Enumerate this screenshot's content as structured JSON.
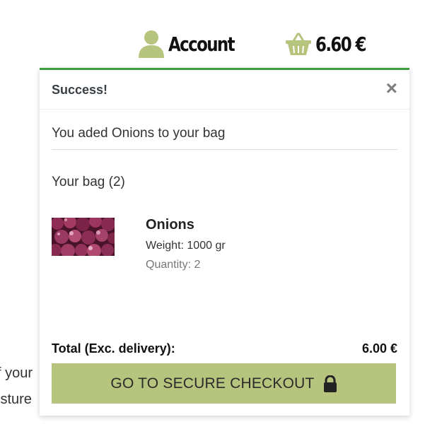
{
  "header": {
    "account_label": "Account",
    "bag_total": "6.60 €",
    "icon_color": "#b6c47e"
  },
  "background": {
    "line1": "f your",
    "line2": "isture"
  },
  "toast": {
    "title": "Success!",
    "close_symbol": "×",
    "message": "You aded Onions to your bag",
    "bag_count": "Your bag (2)",
    "accent_color": "#3d9d3f",
    "item": {
      "name": "Onions",
      "weight": "Weight: 1000 gr",
      "quantity": "Quantity: 2"
    },
    "total_label": "Total (Exc. delivery):",
    "total_value": "6.00 €",
    "checkout_label": "GO TO SECURE CHECKOUT",
    "checkout_color": "#b6c47e"
  }
}
